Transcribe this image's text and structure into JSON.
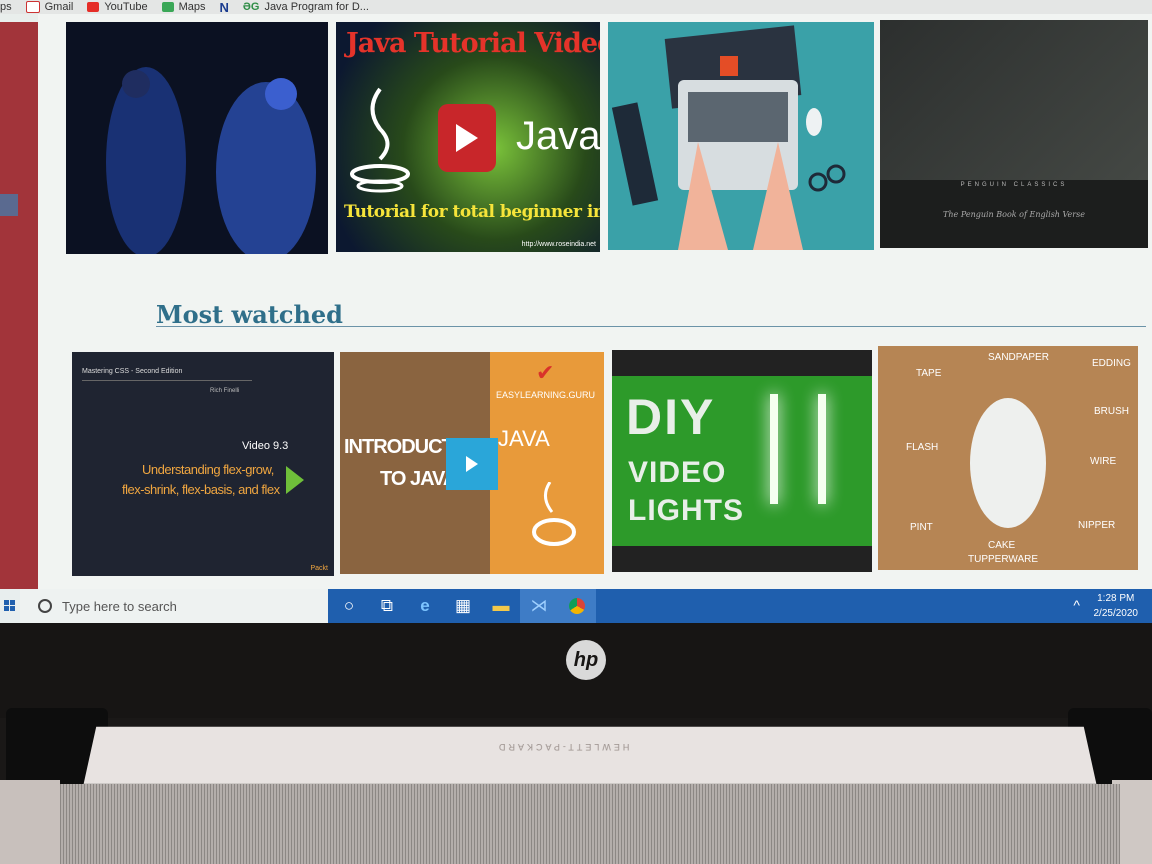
{
  "bookmarks": [
    {
      "label": "ps",
      "icon": "apps-icon"
    },
    {
      "label": "Gmail",
      "icon": "gmail-icon"
    },
    {
      "label": "YouTube",
      "icon": "youtube-icon"
    },
    {
      "label": "Maps",
      "icon": "maps-icon"
    },
    {
      "label": "",
      "icon": "n-icon"
    },
    {
      "label": "Java Program for D...",
      "icon": "geeksforgeeks-icon"
    }
  ],
  "thumbs_top": {
    "java_title": "Java Tutorial Videos",
    "java_word": "Java",
    "java_sub": "Tutorial for total beginner in Java",
    "java_url": "http://www.roseindia.net",
    "book_series": "PENGUIN CLASSICS",
    "book_title": "The Penguin Book of English Verse"
  },
  "section": {
    "title": "Most watched"
  },
  "thumbs_bottom": {
    "css_heading": "Mastering CSS - Second Edition",
    "css_author": "Rich Finelli",
    "css_video": "Video 9.3",
    "css_line1": "Understanding flex-grow,",
    "css_line2": "flex-shrink, flex-basis, and flex",
    "css_brand": "Packt",
    "java_intro1": "INTRODUCTION",
    "java_intro2": "TO JAVA",
    "java_right": "JAVA",
    "easy": "EASYLEARNING.GURU",
    "diy1": "DIY",
    "diy2": "VIDEO",
    "diy3": "LIGHTS",
    "tools": [
      "TAPE",
      "SANDPAPER",
      "EDDING",
      "BRUSH",
      "FLASH",
      "WIRE",
      "PINT",
      "NIPPER",
      "CAKE",
      "TUPPERWARE"
    ]
  },
  "taskbar": {
    "search_placeholder": "Type here to search",
    "time": "1:28 PM",
    "date": "2/25/2020",
    "icons": [
      "cortana-icon",
      "task-view-icon",
      "edge-icon",
      "store-icon",
      "file-explorer-icon",
      "vscode-icon",
      "chrome-icon"
    ]
  },
  "laptop": {
    "logo": "hp",
    "brand": "HEWLETT-PACKARD"
  },
  "colors": {
    "accent": "#2f6f8a",
    "taskbar": "#1f5fae",
    "sidebar": "#a2343a"
  }
}
